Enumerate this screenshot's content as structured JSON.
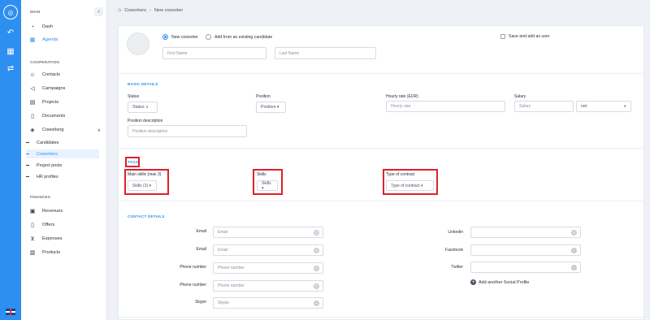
{
  "sidebar": {
    "sections": {
      "main": "MAIN",
      "cooperation": "COOPERATION",
      "finances": "FINANCES"
    },
    "items": [
      {
        "label": "Dash"
      },
      {
        "label": "Agenda"
      },
      {
        "label": "Contacts"
      },
      {
        "label": "Campaigns"
      },
      {
        "label": "Projects"
      },
      {
        "label": "Documents"
      },
      {
        "label": "Coworking"
      },
      {
        "label": "Revenues"
      },
      {
        "label": "Offers"
      },
      {
        "label": "Expenses"
      },
      {
        "label": "Products"
      }
    ],
    "subitems": [
      {
        "label": "Candidates"
      },
      {
        "label": "Coworkers"
      },
      {
        "label": "Project posts"
      },
      {
        "label": "HR profiles"
      }
    ]
  },
  "breadcrumb": {
    "parent": "Coworkers",
    "separator": "›",
    "current": "New coworker"
  },
  "top": {
    "radio_new": "New coworker",
    "radio_existing": "Add from an existing candidate",
    "save_as_user": "Save and add as user",
    "first_name_placeholder": "First Name",
    "last_name_placeholder": "Last Name"
  },
  "basic": {
    "heading": "BASIC DETAILS",
    "status_label": "Status",
    "status_value": "Status ∨",
    "position_label": "Position",
    "position_value": "Position ▾",
    "hourly_label": "Hourly rate (EUR)",
    "hourly_placeholder": "Hourly rate",
    "salary_label": "Salary",
    "salary_placeholder": "Salary",
    "salary_type": "net",
    "position_desc_label": "Position description",
    "position_desc_placeholder": "Position description"
  },
  "tags": {
    "heading": "TAGS",
    "main_skills_label": "Main skills (max 3)",
    "main_skills_value": "Skills (3) ▾",
    "skills_label": "Skills",
    "skills_value": "Skills ▾",
    "contract_label": "Type of contract",
    "contract_value": "Type of contract ▾"
  },
  "contact": {
    "heading": "CONTACT DETAILS",
    "left": [
      {
        "label": "Email",
        "placeholder": "Email"
      },
      {
        "label": "Email",
        "placeholder": "Email"
      },
      {
        "label": "Phone number",
        "placeholder": "Phone number"
      },
      {
        "label": "Phone number",
        "placeholder": "Phone number"
      },
      {
        "label": "Skype",
        "placeholder": "Skype"
      }
    ],
    "right": [
      {
        "label": "Linkedin"
      },
      {
        "label": "Facebook"
      },
      {
        "label": "Twitter"
      }
    ],
    "add_social": "Add another Social Profile"
  },
  "colors": {
    "accent": "#2d8ff0",
    "highlight": "#e0202e"
  }
}
